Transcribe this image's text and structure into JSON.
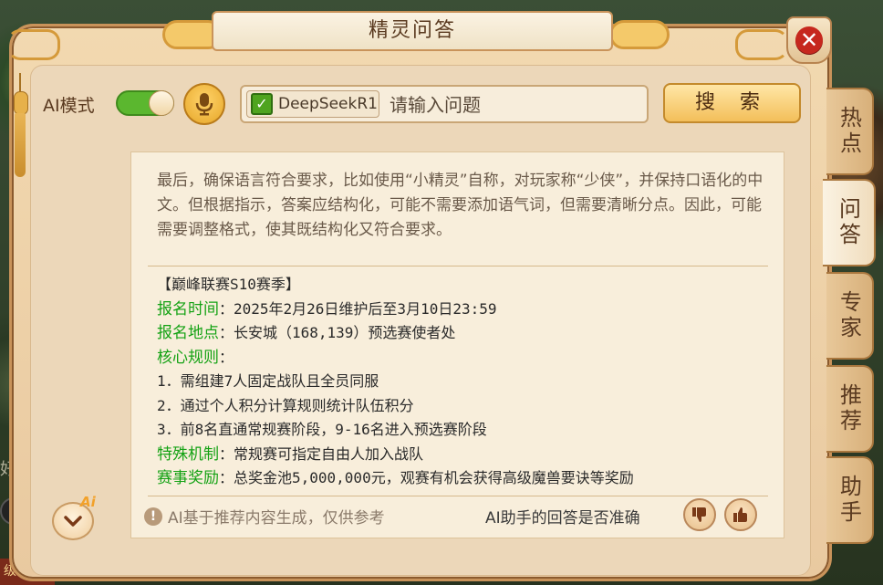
{
  "window": {
    "title": "精灵问答",
    "close_label": "✕"
  },
  "background": {
    "side_text": "好友",
    "bottom_text": "级"
  },
  "toolbar": {
    "ai_mode_label": "AI模式",
    "ai_mode_on": true,
    "model_name": "DeepSeekR1",
    "model_checked": true,
    "search_placeholder": "请输入问题",
    "search_value": "",
    "search_button": "搜 索"
  },
  "content": {
    "reasoning_text": "最后，确保语言符合要求，比如使用“小精灵”自称，对玩家称“少侠”，并保持口语化的中文。但根据指示，答案应结构化，可能不需要添加语气词，但需要清晰分点。因此，可能需要调整格式，使其既结构化又符合要求。",
    "answer": {
      "heading": "【巅峰联赛S10赛季】",
      "signup_time_label": "报名时间",
      "signup_time_value": "：2025年2月26日维护后至3月10日23:59",
      "signup_place_label": "报名地点",
      "signup_place_value": "：长安城（168,139）预选赛使者处",
      "rules_label": "核心规则",
      "rules_suffix": "：",
      "rules": [
        "1．需组建7人固定战队且全员同服",
        "2．通过个人积分计算规则统计队伍积分",
        "3．前8名直通常规赛阶段，9-16名进入预选赛阶段"
      ],
      "special_label": "特殊机制",
      "special_value": "：常规赛可指定自由人加入战队",
      "reward_label": "赛事奖励",
      "reward_value": "：总奖金池5,000,000元，观赛有机会获得高级魔兽要诀等奖励"
    },
    "disclaimer": "AI基于推荐内容生成，仅供参考",
    "feedback_question": "AI助手的回答是否准确"
  },
  "collapse": {
    "badge": "Ai"
  },
  "tabs": [
    {
      "label": "热点",
      "active": false
    },
    {
      "label": "问答",
      "active": true
    },
    {
      "label": "专家",
      "active": false
    },
    {
      "label": "推荐",
      "active": false
    },
    {
      "label": "助手",
      "active": false
    }
  ],
  "colors": {
    "accent_green": "#14a214",
    "toggle_green": "#5bb72f",
    "close_red": "#c6281e"
  }
}
